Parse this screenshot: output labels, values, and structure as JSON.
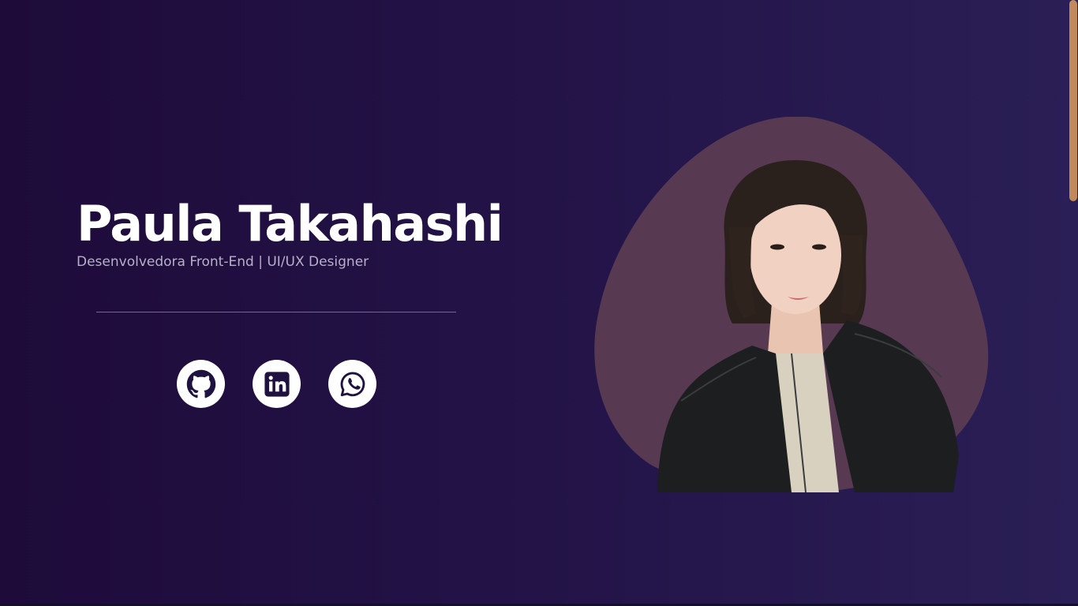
{
  "hero": {
    "name": "Paula Takahashi",
    "role": "Desenvolvedora Front-End | UI/UX Designer"
  },
  "social_links": [
    {
      "name": "GitHub",
      "icon": "github-icon"
    },
    {
      "name": "LinkedIn",
      "icon": "linkedin-icon"
    },
    {
      "name": "WhatsApp",
      "icon": "whatsapp-icon"
    }
  ],
  "photo": {
    "description": "profile-photo"
  },
  "colors": {
    "background_start": "#1e0b3a",
    "background_end": "#2a1f56",
    "accent_line": "#c4502f",
    "blob": "#573a52",
    "icon_fill": "#1f1240",
    "scrollbar_thumb": "#c08a5c"
  }
}
